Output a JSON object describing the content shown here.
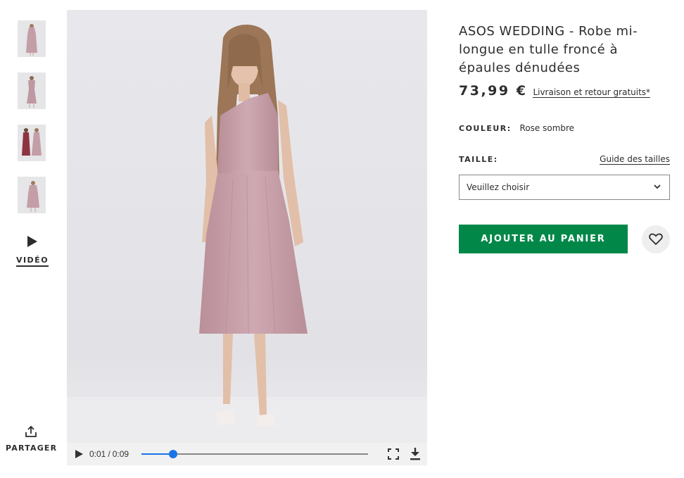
{
  "thumbnails": [
    {
      "alt": "view-1"
    },
    {
      "alt": "view-2"
    },
    {
      "alt": "view-3"
    },
    {
      "alt": "view-4"
    }
  ],
  "video_link": {
    "label": "VIDÉO",
    "icon": "play-icon"
  },
  "share": {
    "label": "PARTAGER",
    "icon": "share-icon"
  },
  "player": {
    "current_time": "0:01",
    "separator": "/",
    "duration": "0:09",
    "progress_fraction": 0.14,
    "icons": [
      "play-icon",
      "fullscreen-icon",
      "download-icon"
    ]
  },
  "product": {
    "title": "ASOS WEDDING - Robe mi-longue en tulle froncé à épaules dénudées",
    "price": "73,99 €",
    "shipping_link": "Livraison et retour gratuits*",
    "colour_label": "COULEUR:",
    "colour_value": "Rose sombre",
    "size_label": "TAILLE:",
    "size_guide": "Guide des tailles",
    "size_select_value": "Veuillez choisir",
    "add_to_bag": "AJOUTER AU PANIER",
    "wishlist_icon": "heart-icon"
  },
  "colors": {
    "add_button": "#018849",
    "dress": "#c9a5ad",
    "text": "#2d2d2d",
    "progress": "#1a73e8"
  }
}
